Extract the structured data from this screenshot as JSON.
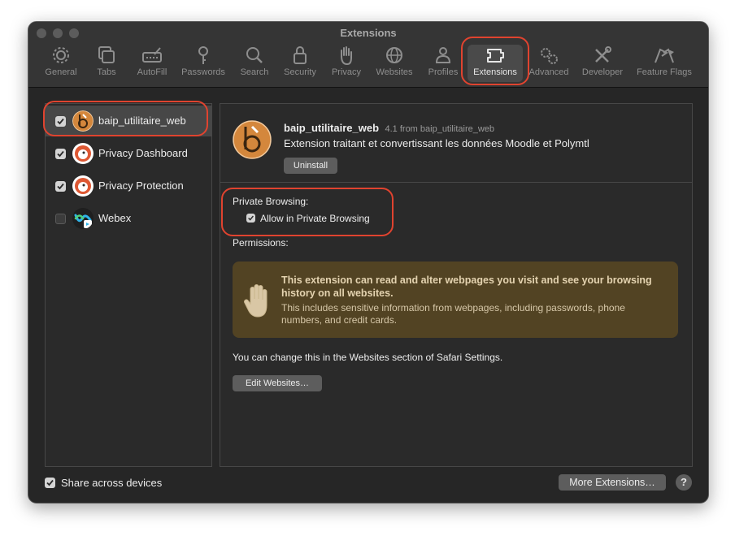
{
  "window": {
    "title": "Extensions"
  },
  "toolbar": {
    "items": [
      {
        "label": "General",
        "icon": "gear-icon"
      },
      {
        "label": "Tabs",
        "icon": "tabs-icon"
      },
      {
        "label": "AutoFill",
        "icon": "autofill-icon"
      },
      {
        "label": "Passwords",
        "icon": "key-icon"
      },
      {
        "label": "Search",
        "icon": "search-icon"
      },
      {
        "label": "Security",
        "icon": "lock-icon"
      },
      {
        "label": "Privacy",
        "icon": "hand-icon"
      },
      {
        "label": "Websites",
        "icon": "globe-icon"
      },
      {
        "label": "Profiles",
        "icon": "person-icon"
      },
      {
        "label": "Extensions",
        "icon": "puzzle-icon",
        "active": true
      },
      {
        "label": "Advanced",
        "icon": "gears-icon"
      },
      {
        "label": "Developer",
        "icon": "tools-icon"
      },
      {
        "label": "Feature Flags",
        "icon": "flags-icon"
      }
    ]
  },
  "sidebar": {
    "items": [
      {
        "label": "baip_utilitaire_web",
        "checked": true,
        "selected": true,
        "icon": "baip-icon"
      },
      {
        "label": "Privacy Dashboard",
        "checked": true,
        "icon": "duckduckgo-icon"
      },
      {
        "label": "Privacy Protection",
        "checked": true,
        "icon": "duckduckgo-icon"
      },
      {
        "label": "Webex",
        "checked": false,
        "icon": "webex-icon"
      }
    ]
  },
  "detail": {
    "name": "baip_utilitaire_web",
    "version_from": "4.1 from baip_utilitaire_web",
    "description": "Extension traitant et convertissant les données Moodle et Polymtl",
    "uninstall_label": "Uninstall",
    "private_browsing_heading": "Private Browsing:",
    "allow_private_label": "Allow in Private Browsing",
    "allow_private_checked": true,
    "permissions_heading": "Permissions:",
    "warning_title": "This extension can read and alter webpages you visit and see your browsing history on all websites.",
    "warning_body": "This includes sensitive information from webpages, including passwords, phone numbers, and credit cards.",
    "websites_note": "You can change this in the Websites section of Safari Settings.",
    "edit_websites_label": "Edit Websites…"
  },
  "footer": {
    "share_label": "Share across devices",
    "share_checked": true,
    "more_extensions_label": "More Extensions…",
    "help_label": "?"
  },
  "colors": {
    "window_bg": "#262626",
    "highlight": "#e0432f",
    "warning_bg": "#524323",
    "baip_orange": "#d4873c"
  }
}
